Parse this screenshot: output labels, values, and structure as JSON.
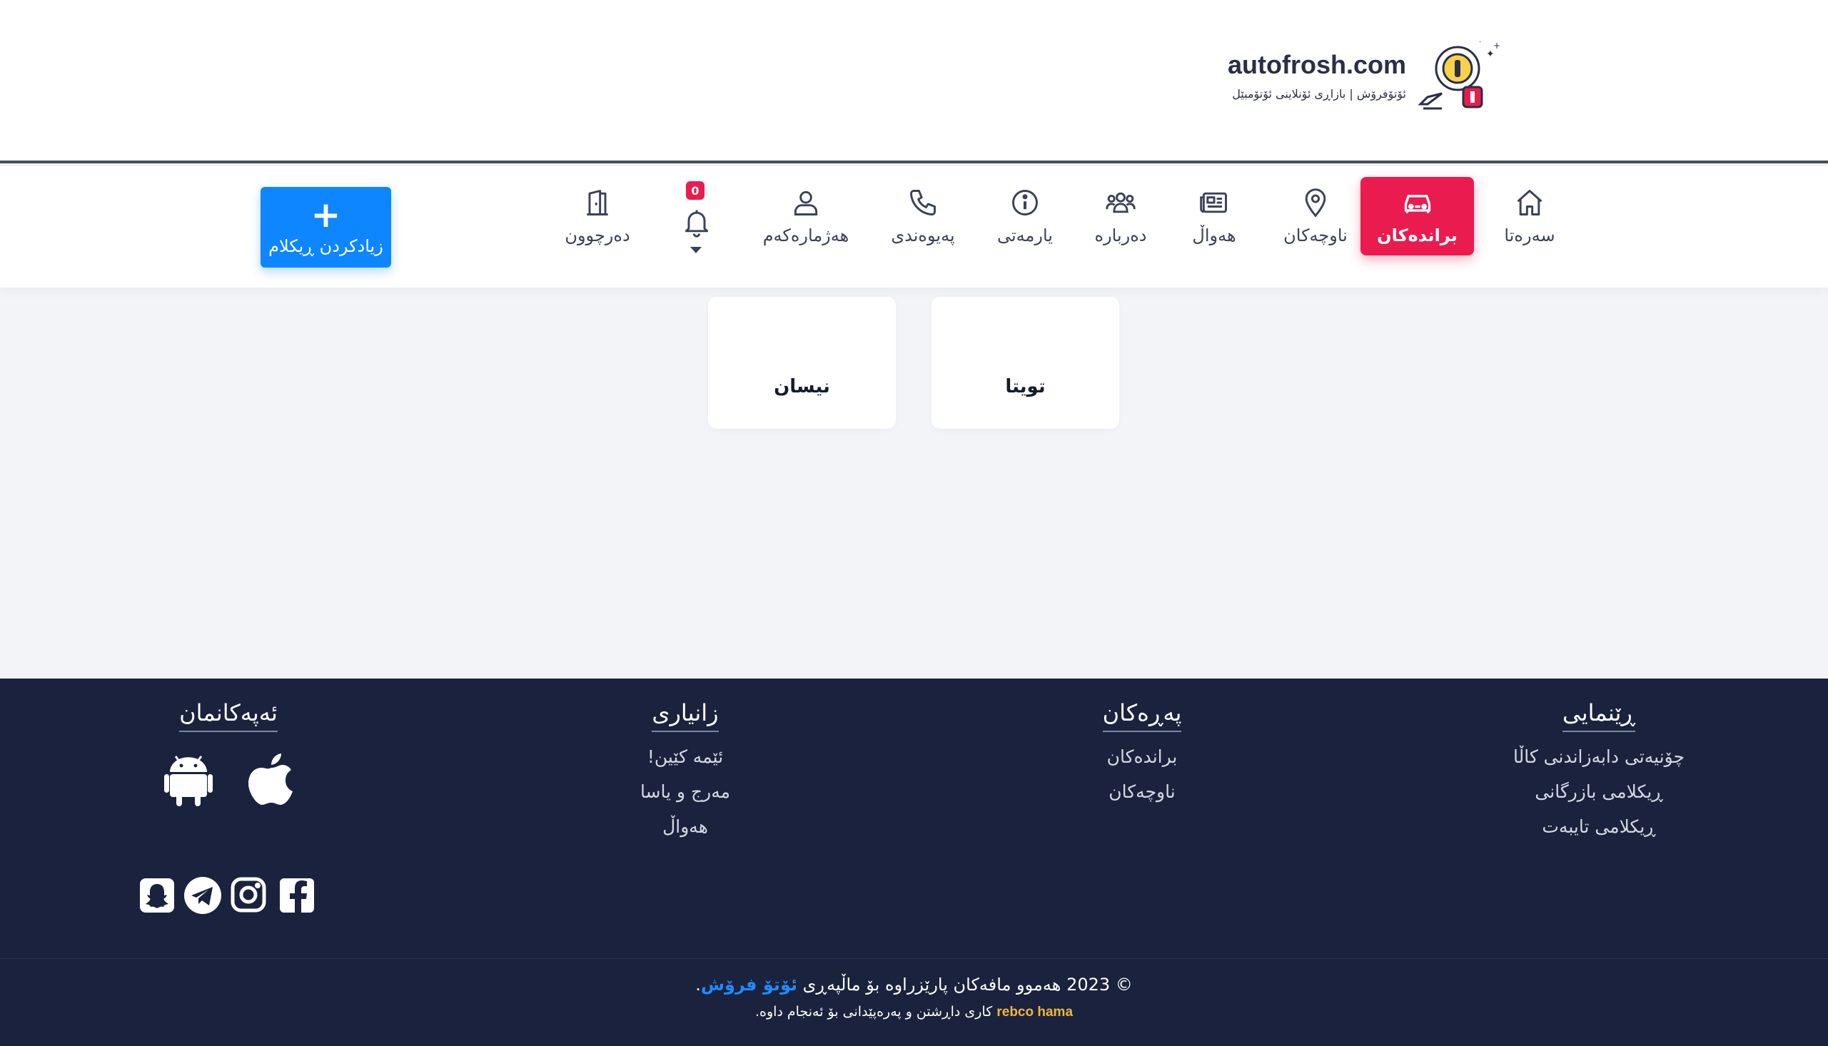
{
  "header": {
    "logo_title": "autofrosh.com",
    "logo_subtitle": "ئۆتۆفرۆش | بازاڕی ئۆنلاینی ئۆتۆمبێل",
    "logo_icon": "car-key-icon"
  },
  "nav": {
    "items": [
      {
        "label": "سەرەتا",
        "icon": "home-icon"
      },
      {
        "label": "براندەکان",
        "icon": "car-icon",
        "active": true
      },
      {
        "label": "ناوچەکان",
        "icon": "map-pin-icon"
      },
      {
        "label": "هەواڵ",
        "icon": "newspaper-icon"
      },
      {
        "label": "دەربارە",
        "icon": "users-icon"
      },
      {
        "label": "یارمەتی",
        "icon": "info-icon"
      },
      {
        "label": "پەیوەندی",
        "icon": "phone-icon"
      },
      {
        "label": "هەژمارەکەم",
        "icon": "user-icon"
      }
    ],
    "notifications_count": "0",
    "logout_label": "دەرچوون",
    "add_ad_label": "زیادکردن ڕیکلام",
    "active_color": "#ea1c4f",
    "add_button_color": "#0d86ff"
  },
  "brands": [
    {
      "name": "تویتا"
    },
    {
      "name": "نیسان"
    }
  ],
  "footer": {
    "guide": {
      "heading": "ڕێنمایی",
      "links": [
        "چۆنیەتی دابەزاندنی کاڵا",
        "ڕیکلامی بازرگانی",
        "ڕیکلامی تایبەت"
      ]
    },
    "pages": {
      "heading": "پەڕەکان",
      "links": [
        "براندەکان",
        "ناوچەکان"
      ]
    },
    "info": {
      "heading": "زانیاری",
      "links": [
        "ئێمە کێین!",
        "مەرج و یاسا",
        "هەواڵ"
      ]
    },
    "apps": {
      "heading": "ئەپەکانمان",
      "icons": [
        "apple-icon",
        "android-icon"
      ]
    },
    "social_icons": [
      "facebook-icon",
      "instagram-icon",
      "telegram-icon",
      "snapchat-icon"
    ],
    "copyright_prefix": "© 2023 هەموو مافەکان پارێزراوە بۆ ماڵپەڕی",
    "copyright_brand": "ئۆتۆ فرۆش",
    "copyright_suffix": ".",
    "credit_prefix": "کاری داڕشتن و پەرەپێدانی بۆ ئەنجام داوە.",
    "credit_dev": "rebco hama",
    "background_color": "#1a223d"
  }
}
